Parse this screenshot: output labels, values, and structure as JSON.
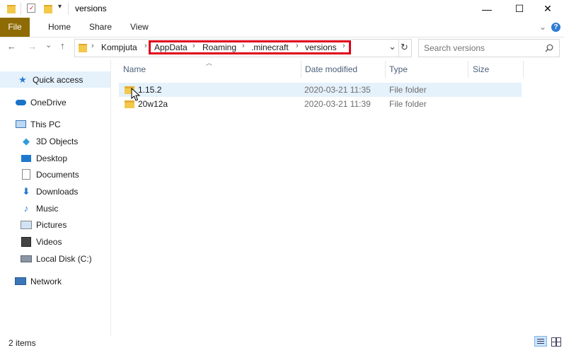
{
  "window": {
    "title": "versions",
    "minimize": "—",
    "maximize": "☐",
    "close": "✕"
  },
  "ribbon": {
    "tabs": [
      "File",
      "Home",
      "Share",
      "View"
    ],
    "expand": "⌄",
    "help": "?"
  },
  "nav": {
    "back": "←",
    "forward": "→",
    "recent": "⌄",
    "up": "↑"
  },
  "address": {
    "crumbs": [
      "Kompjuta",
      "AppData",
      "Roaming",
      ".minecraft",
      "versions"
    ],
    "sep": "›",
    "dropdown": "⌄",
    "refresh": "↻"
  },
  "search": {
    "placeholder": "Search versions"
  },
  "sidebar": {
    "items": [
      {
        "label": "Quick access"
      },
      {
        "label": "OneDrive"
      },
      {
        "label": "This PC"
      },
      {
        "label": "3D Objects"
      },
      {
        "label": "Desktop"
      },
      {
        "label": "Documents"
      },
      {
        "label": "Downloads"
      },
      {
        "label": "Music"
      },
      {
        "label": "Pictures"
      },
      {
        "label": "Videos"
      },
      {
        "label": "Local Disk (C:)"
      },
      {
        "label": "Network"
      }
    ]
  },
  "columns": {
    "name": "Name",
    "date": "Date modified",
    "type": "Type",
    "size": "Size"
  },
  "files": [
    {
      "name": "1.15.2",
      "date": "2020-03-21 11:35",
      "type": "File folder"
    },
    {
      "name": "20w12a",
      "date": "2020-03-21 11:39",
      "type": "File folder"
    }
  ],
  "status": {
    "items": "2 items"
  },
  "colors": {
    "file_tab": "#8e6b04",
    "highlight": "#e0001b",
    "selection": "#e5f1fb",
    "folder": "#f3c94c"
  }
}
